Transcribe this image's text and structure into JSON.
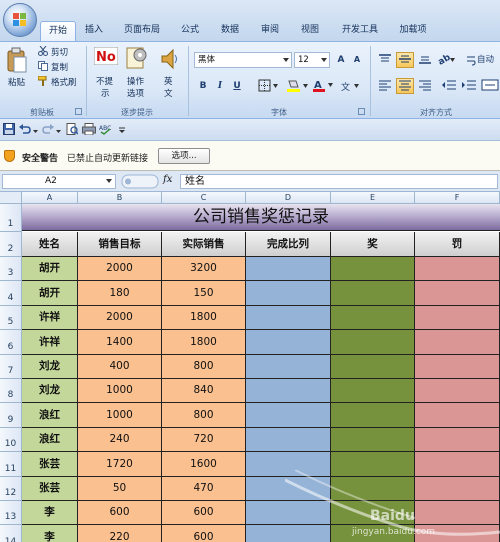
{
  "ribbon_tabs": [
    "开始",
    "插入",
    "页面布局",
    "公式",
    "数据",
    "审阅",
    "视图",
    "开发工具",
    "加载项"
  ],
  "clipboard": {
    "paste": "粘贴",
    "cut": "剪切",
    "copy": "复制",
    "format_painter": "格式刷",
    "group": "剪贴板"
  },
  "reminder": {
    "no_prompt_1": "不提",
    "no_prompt_2": "示",
    "action_1": "操作",
    "action_2": "选项",
    "english_1": "英",
    "english_2": "文",
    "group": "逐步提示"
  },
  "font": {
    "name": "黑体",
    "size": "12",
    "bold": "B",
    "italic": "I",
    "underline": "U",
    "grow": "A",
    "shrink": "A",
    "color_letter": "A",
    "group": "字体"
  },
  "alignment": {
    "group": "对齐方式",
    "auto_wrap": "自动"
  },
  "security": {
    "title": "安全警告",
    "message": "已禁止自动更新链接",
    "options_button": "选项..."
  },
  "formula_bar": {
    "name_box": "A2",
    "fx": "fx",
    "formula": "姓名"
  },
  "columns": [
    "A",
    "B",
    "C",
    "D",
    "E",
    "F"
  ],
  "row_numbers": [
    "1",
    "2",
    "3",
    "4",
    "5",
    "6",
    "7",
    "8",
    "9",
    "10",
    "11",
    "12",
    "13",
    "14"
  ],
  "sheet": {
    "title": "公司销售奖惩记录",
    "headers": [
      "姓名",
      "销售目标",
      "实际销售",
      "完成比列",
      "奖",
      "罚"
    ],
    "rows": [
      {
        "name": "胡开",
        "target": "2000",
        "actual": "3200"
      },
      {
        "name": "胡开",
        "target": "180",
        "actual": "150"
      },
      {
        "name": "许祥",
        "target": "2000",
        "actual": "1800"
      },
      {
        "name": "许祥",
        "target": "1400",
        "actual": "1800"
      },
      {
        "name": "刘龙",
        "target": "400",
        "actual": "800"
      },
      {
        "name": "刘龙",
        "target": "1000",
        "actual": "840"
      },
      {
        "name": "浪红",
        "target": "1000",
        "actual": "800"
      },
      {
        "name": "浪红",
        "target": "240",
        "actual": "720"
      },
      {
        "name": "张芸",
        "target": "1720",
        "actual": "1600"
      },
      {
        "name": "张芸",
        "target": "50",
        "actual": "470"
      },
      {
        "name": "李",
        "target": "600",
        "actual": "600"
      },
      {
        "name": "李",
        "target": "220",
        "actual": "600"
      }
    ]
  },
  "watermark": {
    "brand": "Baidu",
    "url": "jingyan.baidu.com"
  },
  "colors": {
    "name_col": "#c4d79b",
    "number_cols": "#fac090",
    "ratio_col": "#95b3d7",
    "reward_col": "#76923c",
    "penalty_col": "#da9694",
    "title_band": "#7d6b9f"
  }
}
